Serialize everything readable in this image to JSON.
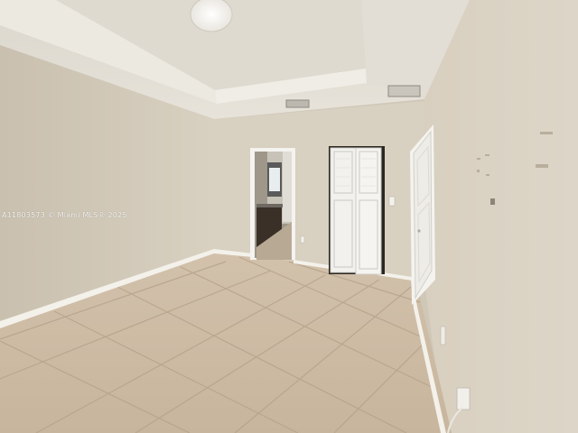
{
  "photo": {
    "subject": "empty room",
    "watermark": "A11803573 © Miami MLS® 2025"
  },
  "colors": {
    "wall_left": "#cfc6b6",
    "wall_back": "#d9d1c1",
    "wall_right": "#ddd5c6",
    "ceiling": "#e6e2d8",
    "floor_tile": "#c9b7a1",
    "grout": "#b2a08a",
    "baseboard": "#f3f1ea",
    "door_white": "#f2f1ee"
  }
}
